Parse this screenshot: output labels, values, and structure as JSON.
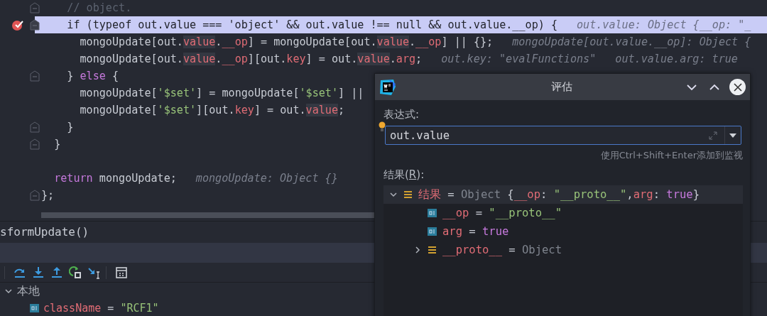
{
  "editor": {
    "lines": [
      {
        "kind": "code",
        "fold": true,
        "tokens": [
          {
            "text": "    // object.",
            "kind": "comment"
          }
        ]
      },
      {
        "kind": "code",
        "fold": true,
        "current": true,
        "breakpoint": true,
        "tokens": [
          {
            "text": "    if (typeof out.value === 'object' && out.value !== null && out.value.__op) {",
            "kind": "plain"
          }
        ],
        "hints": [
          "out.value: Object {__op: \"_"
        ]
      },
      {
        "kind": "code",
        "tokens": [
          {
            "text": "      mongoUpdate[out.",
            "kind": "plain"
          },
          {
            "text": "value",
            "kind": "usage"
          },
          {
            "text": ".",
            "kind": "plain"
          },
          {
            "text": "__op",
            "kind": "prop"
          },
          {
            "text": "] = mongoUpdate[out.",
            "kind": "plain"
          },
          {
            "text": "value",
            "kind": "usage"
          },
          {
            "text": ".",
            "kind": "plain"
          },
          {
            "text": "__op",
            "kind": "prop"
          },
          {
            "text": "] || {};",
            "kind": "plain"
          }
        ],
        "hints": [
          "mongoUpdate[out.value.__op]: Object {"
        ]
      },
      {
        "kind": "code",
        "tokens": [
          {
            "text": "      mongoUpdate[out.",
            "kind": "plain"
          },
          {
            "text": "value",
            "kind": "usage"
          },
          {
            "text": ".",
            "kind": "plain"
          },
          {
            "text": "__op",
            "kind": "prop"
          },
          {
            "text": "][out.",
            "kind": "plain"
          },
          {
            "text": "key",
            "kind": "prop"
          },
          {
            "text": "] = out.",
            "kind": "plain"
          },
          {
            "text": "value",
            "kind": "usage"
          },
          {
            "text": ".",
            "kind": "plain"
          },
          {
            "text": "arg",
            "kind": "prop"
          },
          {
            "text": ";",
            "kind": "plain"
          }
        ],
        "hints": [
          "out.key: \"evalFunctions\"",
          "out.value.arg: true"
        ]
      },
      {
        "kind": "code",
        "fold": true,
        "tokens": [
          {
            "text": "    } ",
            "kind": "plain"
          },
          {
            "text": "else",
            "kind": "kw"
          },
          {
            "text": " {",
            "kind": "plain"
          }
        ]
      },
      {
        "kind": "code",
        "tokens": [
          {
            "text": "      mongoUpdate[",
            "kind": "plain"
          },
          {
            "text": "'$set'",
            "kind": "str"
          },
          {
            "text": "] = mongoUpdate[",
            "kind": "plain"
          },
          {
            "text": "'$set'",
            "kind": "str"
          },
          {
            "text": "] ||",
            "kind": "plain"
          }
        ]
      },
      {
        "kind": "code",
        "tokens": [
          {
            "text": "      mongoUpdate[",
            "kind": "plain"
          },
          {
            "text": "'$set'",
            "kind": "str"
          },
          {
            "text": "][out.",
            "kind": "plain"
          },
          {
            "text": "key",
            "kind": "prop"
          },
          {
            "text": "] = out.",
            "kind": "plain"
          },
          {
            "text": "value",
            "kind": "usage"
          },
          {
            "text": ";",
            "kind": "plain"
          }
        ]
      },
      {
        "kind": "code",
        "fold": true,
        "tokens": [
          {
            "text": "    }",
            "kind": "plain"
          }
        ]
      },
      {
        "kind": "code",
        "fold": true,
        "tokens": [
          {
            "text": "  }",
            "kind": "plain"
          }
        ]
      },
      {
        "kind": "blank"
      },
      {
        "kind": "code",
        "tokens": [
          {
            "text": "  return",
            "kind": "kw"
          },
          {
            "text": " mongoUpdate;",
            "kind": "plain"
          }
        ],
        "hints": [
          "mongoUpdate: Object {}"
        ]
      },
      {
        "kind": "code",
        "fold": true,
        "tokens": [
          {
            "text": "};",
            "kind": "plain"
          }
        ]
      }
    ]
  },
  "frames": [
    {
      "label": "sformUpdate()"
    }
  ],
  "variables": {
    "group": "本地",
    "expanded": true,
    "children": [
      {
        "name": "className",
        "kind": "primitive",
        "value": [
          {
            "text": " = ",
            "kind": "plain"
          },
          {
            "text": "\"RCF1\"",
            "kind": "str"
          }
        ]
      }
    ]
  },
  "dialog": {
    "title": "评估",
    "expression_label": "表达式:",
    "expression": "out.value",
    "hint": "使用Ctrl+Shift+Enter添加到监视",
    "result_label": {
      "before": "结果(",
      "mnemonic": "R",
      "after": "):"
    },
    "result": [
      {
        "name": "结果",
        "kind": "object",
        "expanded": true,
        "selected": true,
        "value": [
          {
            "text": " = ",
            "kind": "plain"
          },
          {
            "text": "Object ",
            "kind": "type"
          },
          {
            "text": "{",
            "kind": "plain"
          },
          {
            "text": "__op",
            "kind": "prop"
          },
          {
            "text": ": ",
            "kind": "plain"
          },
          {
            "text": "\"__proto__\"",
            "kind": "str"
          },
          {
            "text": ",",
            "kind": "plain"
          },
          {
            "text": "arg",
            "kind": "prop"
          },
          {
            "text": ": ",
            "kind": "plain"
          },
          {
            "text": "true",
            "kind": "kw"
          },
          {
            "text": "}",
            "kind": "plain"
          }
        ],
        "children": [
          {
            "name": "__op",
            "kind": "primitive",
            "selected": false,
            "value": [
              {
                "text": " = ",
                "kind": "plain"
              },
              {
                "text": "\"__proto__\"",
                "kind": "str"
              }
            ]
          },
          {
            "name": "arg",
            "kind": "primitive",
            "selected": false,
            "value": [
              {
                "text": " = ",
                "kind": "plain"
              },
              {
                "text": "true",
                "kind": "kw"
              }
            ]
          },
          {
            "name": "__proto__",
            "kind": "object",
            "expanded": false,
            "selected": false,
            "value": [
              {
                "text": " = ",
                "kind": "plain"
              },
              {
                "text": "Object",
                "kind": "type"
              }
            ]
          }
        ]
      }
    ]
  }
}
